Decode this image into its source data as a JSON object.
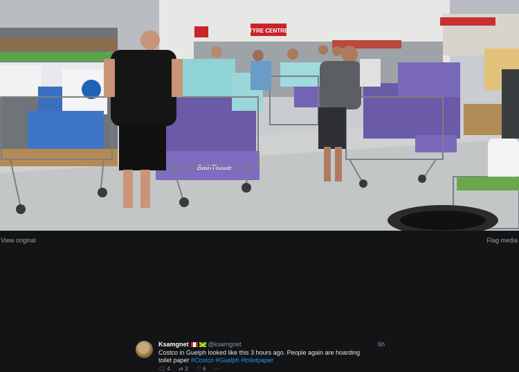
{
  "media": {
    "store_sign": "TYRE CENTRE",
    "pack_brand": "BathTissue",
    "view_original": "View original",
    "flag_media": "Flag media"
  },
  "tweet": {
    "name": "Ksamgnet",
    "handle": "@ksamgnet",
    "time": "6h",
    "text_prefix": "Costco in Guelph looked like this 3 hours ago. People again are hoarding toilet paper ",
    "hashtags": [
      "#Costco",
      "#Guelph",
      "#toiletpaper"
    ],
    "replies": "4",
    "retweets": "3",
    "likes": "6",
    "more": "···"
  }
}
